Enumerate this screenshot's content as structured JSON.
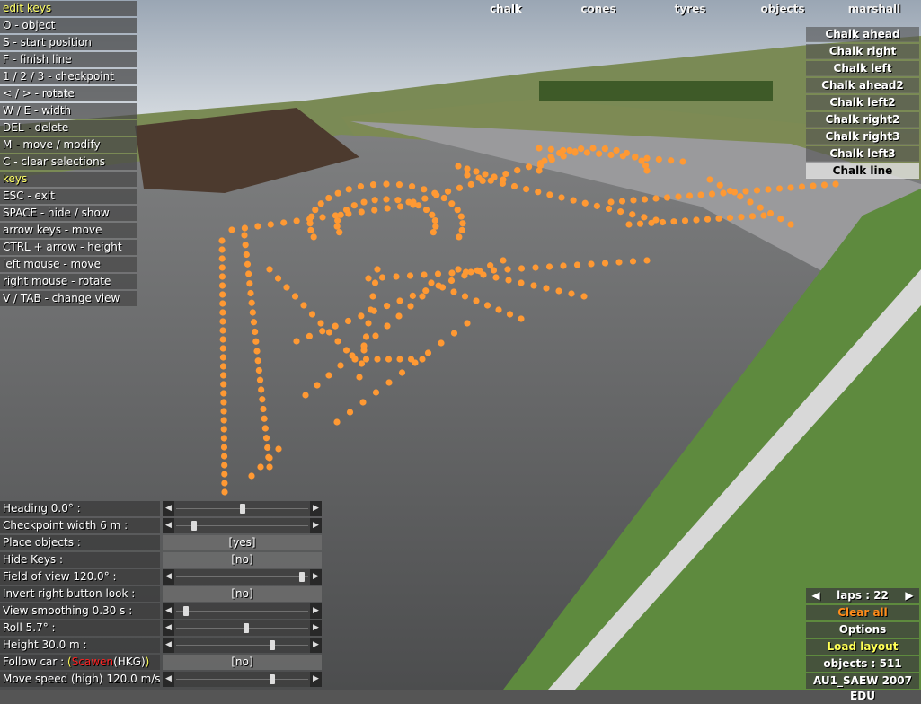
{
  "top_menu": [
    "chalk",
    "cones",
    "tyres",
    "objects",
    "marshall"
  ],
  "top_menu_selected": 0,
  "chalk_list": [
    "Chalk ahead",
    "Chalk right",
    "Chalk left",
    "Chalk ahead2",
    "Chalk left2",
    "Chalk right2",
    "Chalk right3",
    "Chalk left3",
    "Chalk line"
  ],
  "chalk_selected": 8,
  "edit_keys": {
    "title": "edit keys",
    "items": [
      "O - object",
      "S - start position",
      "F - finish line",
      "1 / 2 / 3 - checkpoint",
      "< / > - rotate",
      "W / E - width",
      "DEL - delete",
      "M - move / modify",
      "C - clear selections"
    ]
  },
  "keys": {
    "title": "keys",
    "items": [
      "ESC - exit",
      "SPACE - hide / show",
      "arrow keys - move",
      "CTRL + arrow - height",
      "left mouse - move",
      "right mouse - rotate",
      "V / TAB - change view"
    ]
  },
  "options": [
    {
      "label": "Heading 0.0° :",
      "kind": "slider",
      "level": 0.5
    },
    {
      "label": "Checkpoint width 6 m :",
      "kind": "slider",
      "level": 0.12
    },
    {
      "label": "Place objects :",
      "kind": "toggle",
      "value": "[yes]"
    },
    {
      "label": "Hide Keys :",
      "kind": "toggle",
      "value": "[no]"
    },
    {
      "label": "Field of view 120.0° :",
      "kind": "slider",
      "level": 0.97
    },
    {
      "label": "Invert right button look :",
      "kind": "toggle",
      "value": "[no]"
    },
    {
      "label": "View smoothing 0.30 s :",
      "kind": "slider",
      "level": 0.06
    },
    {
      "label": "Roll 5.7° :",
      "kind": "slider",
      "level": 0.53
    },
    {
      "label": "Height 30.0 m :",
      "kind": "slider",
      "level": 0.74
    },
    {
      "label": "Follow car :",
      "kind": "toggle",
      "value": "[no]"
    },
    {
      "label": "Move speed (high) 120.0 m/s :",
      "kind": "slider",
      "level": 0.74
    }
  ],
  "follow_car": {
    "open": "(",
    "name": "Scawen",
    "team": "(HKG)",
    "close": ")"
  },
  "bottom_right": {
    "laps": "laps : 22",
    "clear_all": "Clear all",
    "options": "Options",
    "load_layout": "Load layout",
    "objects": "objects : 511",
    "track": "AU1_SAEW 2007 EDU"
  },
  "colors": {
    "clear_all": "#ff8c1a",
    "load_layout": "#ffff55",
    "chalk_dot": "#ff9933",
    "header": "#ffff66",
    "driver_name": "#ff2020"
  }
}
